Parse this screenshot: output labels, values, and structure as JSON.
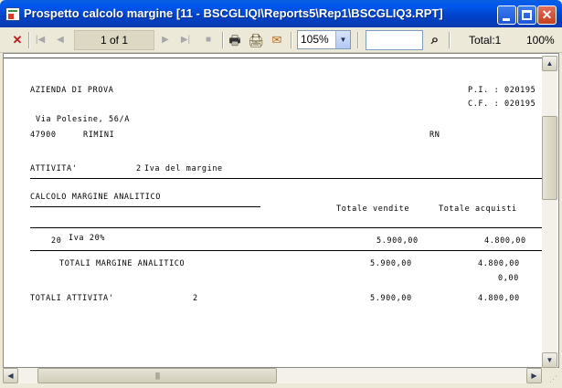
{
  "window": {
    "title": "Prospetto calcolo margine [11 - BSCGLIQI\\Reports5\\Rep1\\BSCGLIQ3.RPT]",
    "minimize_label": "",
    "maximize_label": "",
    "close_label": "✕"
  },
  "toolbar": {
    "close_glyph": "✕",
    "first_glyph": "|◀",
    "prev_glyph": "◀",
    "page_label": "1 of 1",
    "next_glyph": "▶",
    "last_glyph": "▶|",
    "stop_glyph": "■",
    "print_glyph": "🖶",
    "setup_glyph": "🖨",
    "export_glyph": "✉",
    "zoom_value": "105%",
    "zoom_arrow": "▼",
    "search_value": "",
    "find_glyph": "⌕",
    "total_label": "Total:1",
    "percent_label": "100%"
  },
  "report": {
    "company": "AZIENDA DI PROVA",
    "piva_label": "P.I. : 020195",
    "cf_label": "C.F. : 020195",
    "address": "Via Polesine, 56/A",
    "cap": "47900",
    "city": "RIMINI",
    "province": "RN",
    "attivita_label": "ATTIVITA'",
    "attivita_code": "2",
    "attivita_desc": "Iva del margine",
    "section_title": "CALCOLO MARGINE ANALITICO",
    "col_vendite": "Totale vendite",
    "col_acquisti": "Totale acquisti",
    "row_code": "20",
    "row_desc": "Iva 20%",
    "row_vendite": "5.900,00",
    "row_acquisti": "4.800,00",
    "totali_label": "TOTALI MARGINE ANALITICO",
    "totali_vendite": "5.900,00",
    "totali_acquisti": "4.800,00",
    "totali_extra": "0,00",
    "totali_attivita_label": "TOTALI ATTIVITA'",
    "totali_attivita_code": "2",
    "totali_attivita_vendite": "5.900,00",
    "totali_attivita_acquisti": "4.800,00"
  },
  "scrollbar": {
    "up_arrow": "▲",
    "down_arrow": "▼",
    "left_arrow": "◀",
    "right_arrow": "▶",
    "thumb_grip": "||||"
  }
}
